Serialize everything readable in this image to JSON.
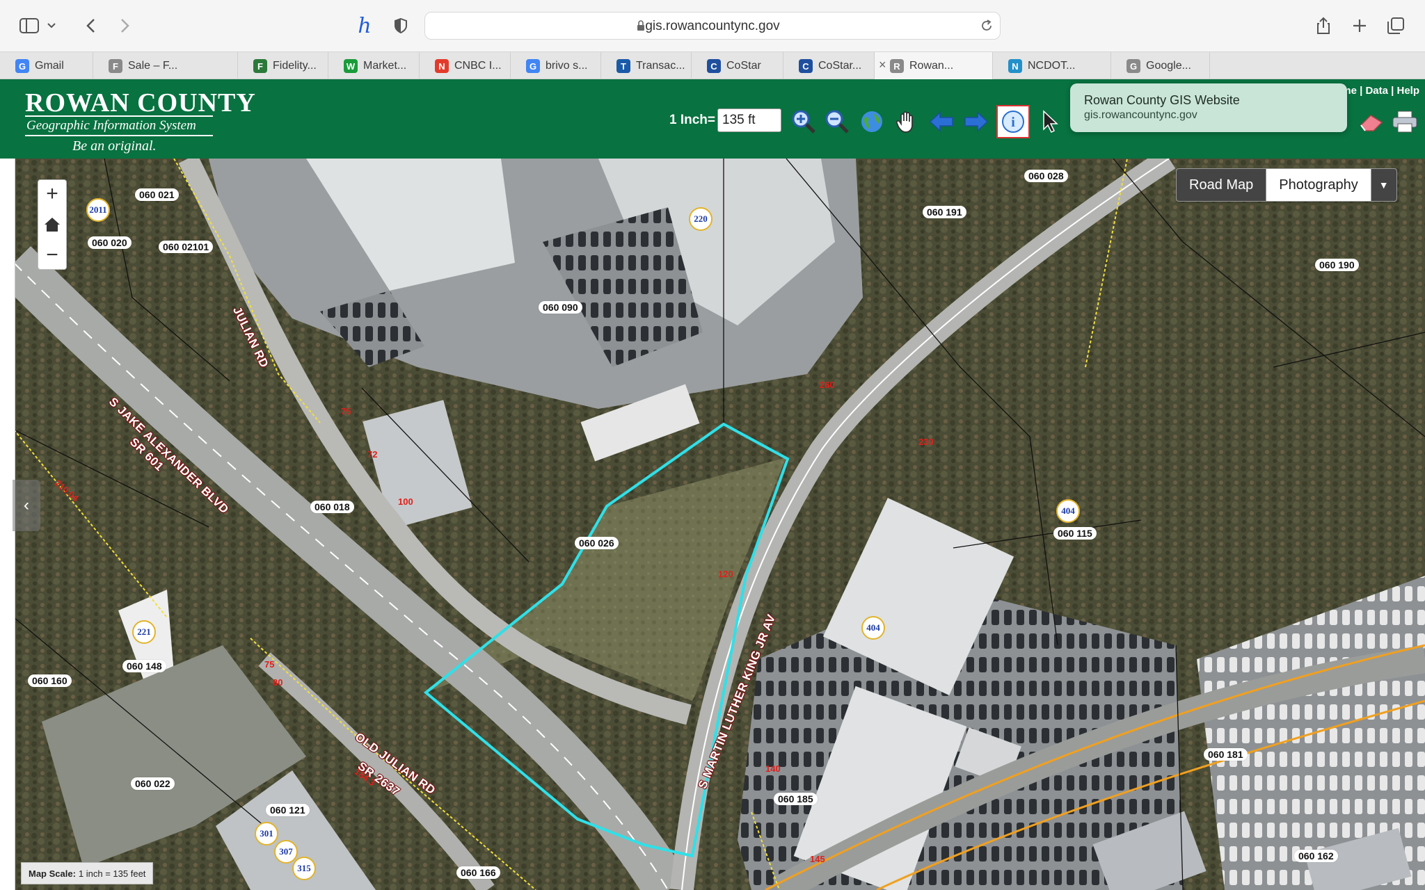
{
  "browser": {
    "url": "gis.rowancountync.gov",
    "tabs": [
      {
        "label": "Gmail",
        "icon": "G",
        "color": "#4285f4"
      },
      {
        "label": "Sale – F...",
        "icon": "F",
        "color": "#8a8a8a"
      },
      {
        "label": "Fidelity...",
        "icon": "F",
        "color": "#2c7a3a"
      },
      {
        "label": "Market...",
        "icon": "W",
        "color": "#1a9b3a"
      },
      {
        "label": "CNBC I...",
        "icon": "N",
        "color": "#e33b2b"
      },
      {
        "label": "brivo s...",
        "icon": "G",
        "color": "#4285f4"
      },
      {
        "label": "Transac...",
        "icon": "T",
        "color": "#1a5aa8"
      },
      {
        "label": "CoStar",
        "icon": "C",
        "color": "#1f4f9e"
      },
      {
        "label": "CoStar...",
        "icon": "C",
        "color": "#1f4f9e"
      },
      {
        "label": "Rowan...",
        "icon": "R",
        "color": "#8a8a8a",
        "active": true
      },
      {
        "label": "NCDOT...",
        "icon": "N",
        "color": "#2390c9"
      },
      {
        "label": "Google...",
        "icon": "G",
        "color": "#8a8a8a"
      }
    ],
    "popover": {
      "title": "Rowan County GIS Website",
      "url": "gis.rowancountync.gov"
    }
  },
  "header": {
    "logo_title": "ROWAN COUNTY",
    "logo_subtitle": "Geographic Information System",
    "logo_tagline": "Be an original.",
    "scale_label": "1 Inch=",
    "scale_value": "135 ft",
    "links": "me | Data | Help",
    "tools": [
      "zoom-in-icon",
      "zoom-out-icon",
      "globe-icon",
      "pan-hand-icon",
      "back-arrow-icon",
      "forward-arrow-icon",
      "info-icon",
      "select-arrow-icon",
      "eraser-icon",
      "print-icon"
    ]
  },
  "map": {
    "basemap_options": [
      "Road Map",
      "Photography"
    ],
    "basemap_selected": "Road Map",
    "scale_text_bold": "Map Scale:",
    "scale_text": "1 inch = 135 feet",
    "parcels": [
      "060 021",
      "060 020",
      "060 02101",
      "060 090",
      "060 191",
      "060 190",
      "060 028",
      "060 018",
      "060 026",
      "060 115",
      "060 148",
      "060 160",
      "060 022",
      "060 121",
      "060 166",
      "060 185",
      "060 181",
      "060 162"
    ],
    "roads": [
      "JULIAN RD",
      "S JAKE ALEXANDER BLVD",
      "SR 601",
      "S MARTIN LUTHER KING JR AV",
      "OLD JULIAN RD",
      "SR 2637"
    ],
    "addresses": [
      "2011",
      "220",
      "404",
      "404",
      "221",
      "301",
      "307",
      "315"
    ],
    "dimensions": [
      "75",
      "72",
      "100",
      "75",
      "80",
      "210.04",
      "120",
      "260",
      "230",
      "140",
      "145",
      "184.3"
    ]
  }
}
